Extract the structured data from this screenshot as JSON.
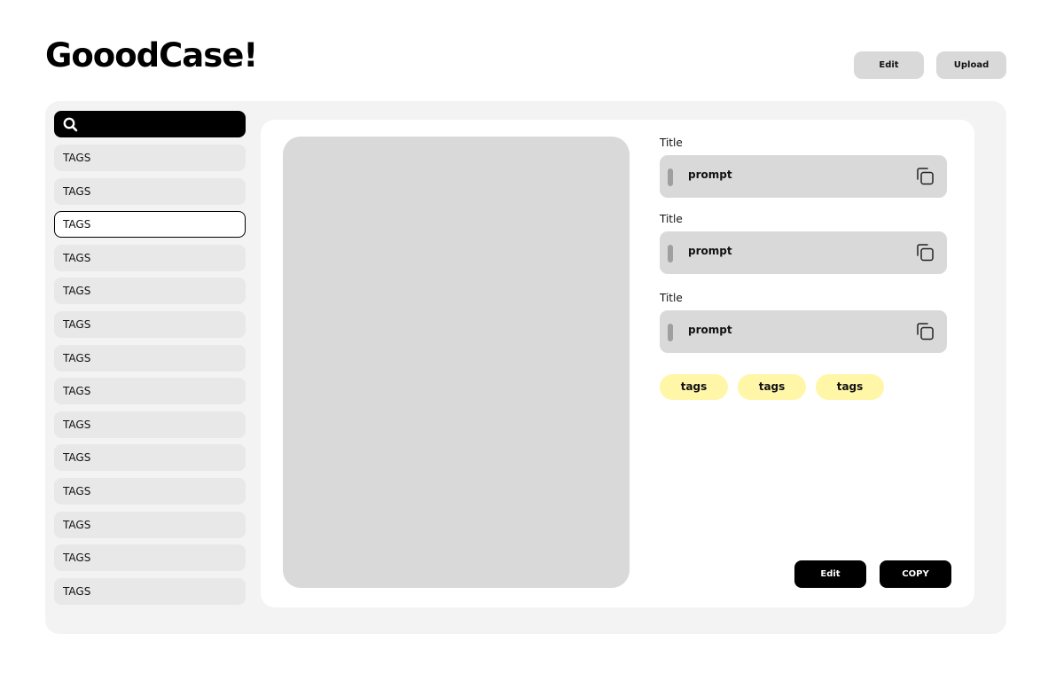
{
  "header": {
    "logo": "GooodCase!",
    "edit_label": "Edit",
    "upload_label": "Upload"
  },
  "sidebar": {
    "search": {
      "value": "",
      "placeholder": ""
    },
    "selected_index": 2,
    "items": [
      "TAGS",
      "TAGS",
      "TAGS",
      "TAGS",
      "TAGS",
      "TAGS",
      "TAGS",
      "TAGS",
      "TAGS",
      "TAGS",
      "TAGS",
      "TAGS",
      "TAGS",
      "TAGS"
    ]
  },
  "detail": {
    "fields": [
      {
        "title": "Title",
        "prompt": "prompt"
      },
      {
        "title": "Title",
        "prompt": "prompt"
      },
      {
        "title": "Title",
        "prompt": "prompt"
      }
    ],
    "tags": [
      "tags",
      "tags",
      "tags"
    ],
    "edit_label": "Edit",
    "copy_label": "COPY"
  },
  "colors": {
    "panel_bg": "#f3f3f3",
    "placeholder_gray": "#d9d9d9",
    "tag_chip": "#fff6a8",
    "primary_button": "#000000"
  },
  "icons": {
    "search": "search-icon",
    "copy": "copy-icon"
  }
}
